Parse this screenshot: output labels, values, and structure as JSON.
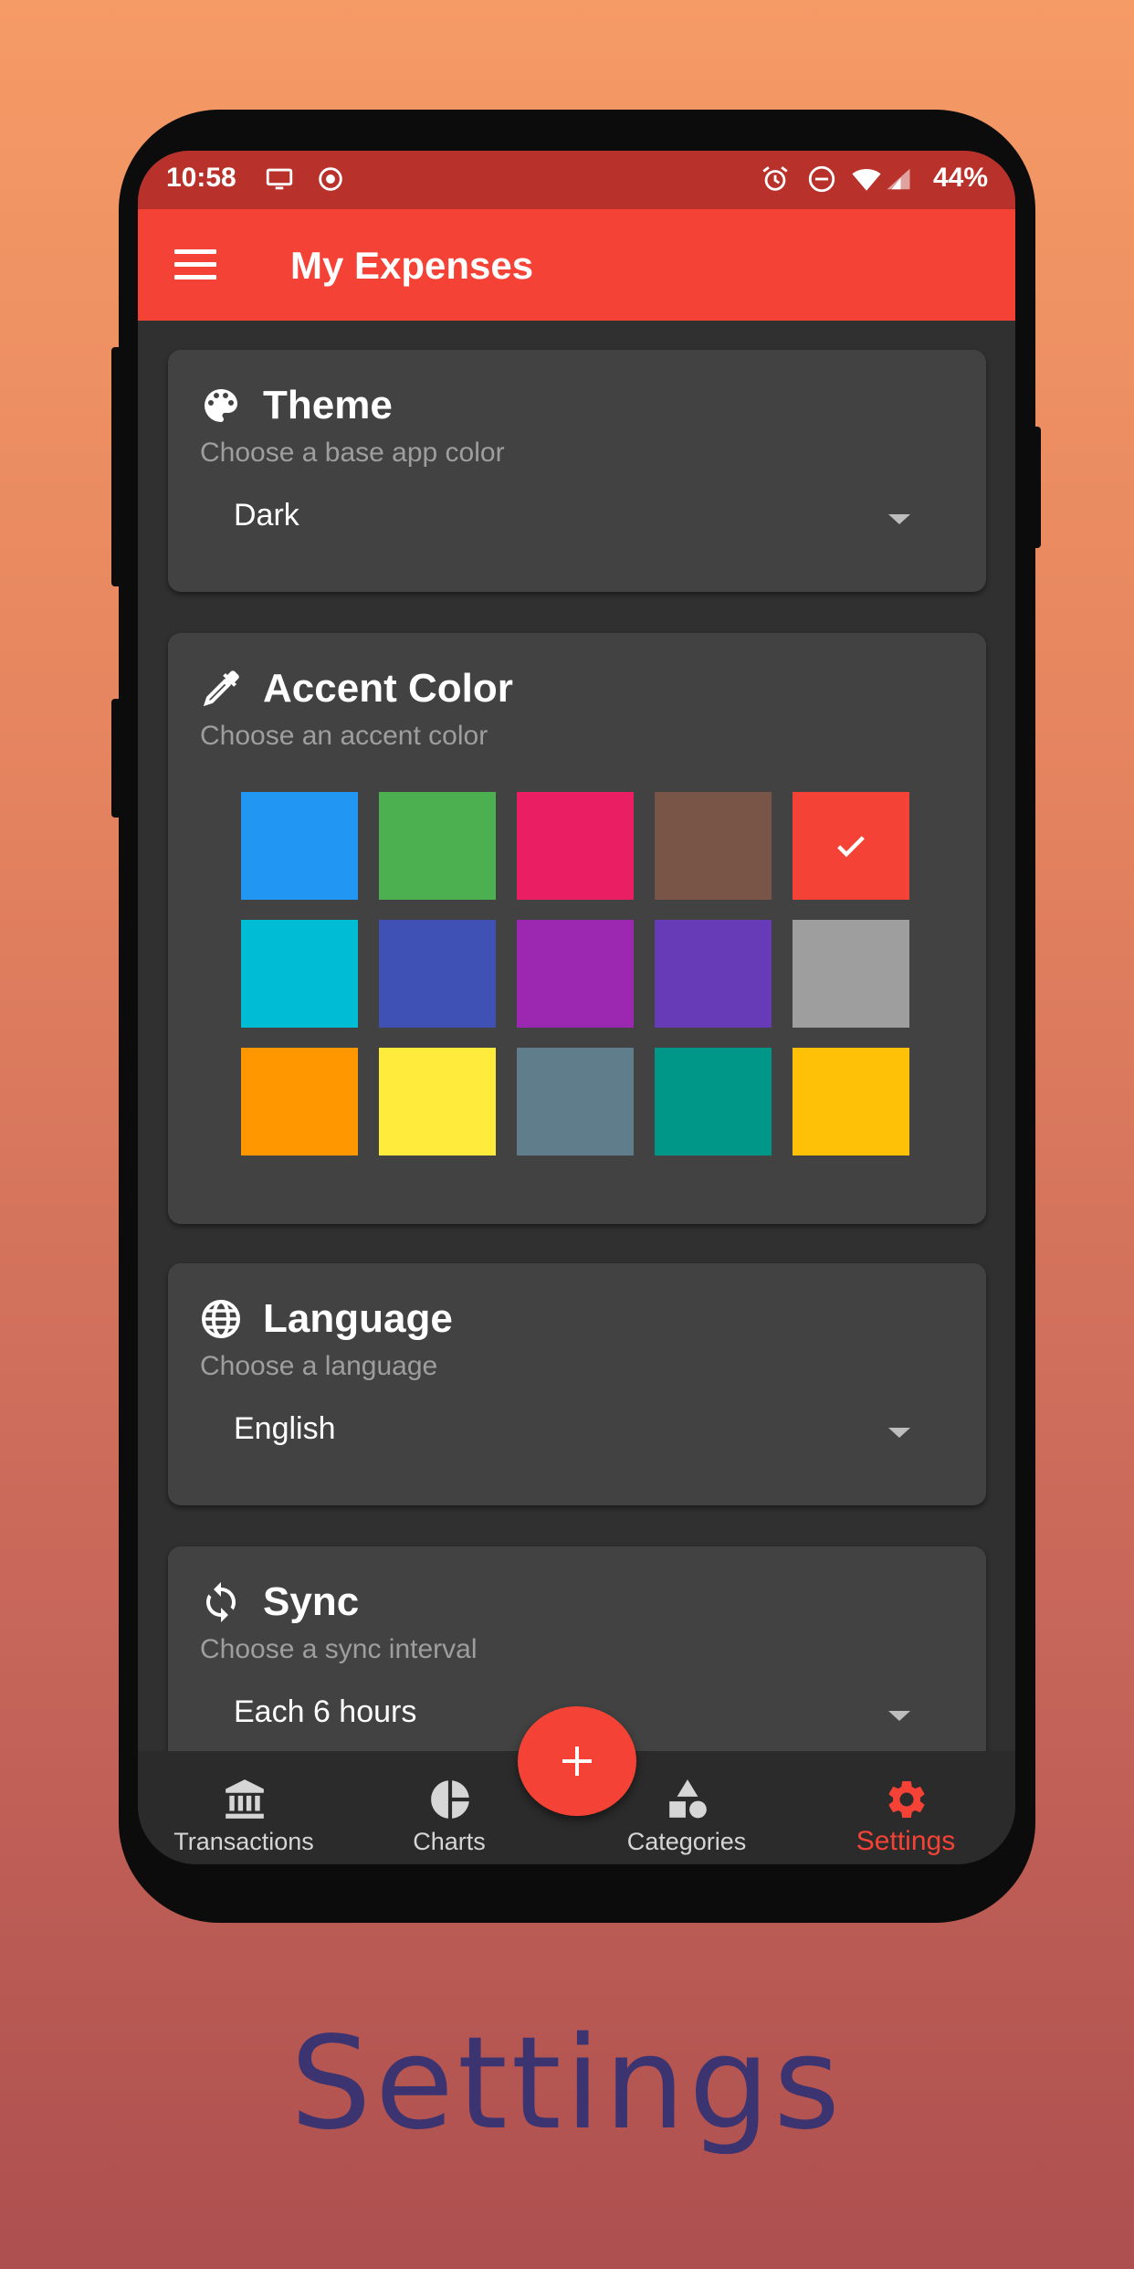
{
  "status_bar": {
    "time": "10:58",
    "battery": "44%",
    "icons": [
      "cast-icon",
      "record-icon",
      "alarm-icon",
      "dnd-icon",
      "wifi-icon",
      "signal-icon"
    ]
  },
  "app_bar": {
    "title": "My Expenses",
    "menu_icon": "hamburger-menu-icon"
  },
  "settings": {
    "theme": {
      "title": "Theme",
      "subtitle": "Choose a base app color",
      "value": "Dark",
      "icon": "palette-icon"
    },
    "accent": {
      "title": "Accent Color",
      "subtitle": "Choose an accent color",
      "icon": "eyedropper-icon",
      "selected_index": 4,
      "colors": [
        "#2196f3",
        "#4caf50",
        "#e91e63",
        "#795548",
        "#f44336",
        "#00bcd4",
        "#3f51b5",
        "#9c27b0",
        "#673ab7",
        "#9e9e9e",
        "#ff9800",
        "#ffeb3b",
        "#607d8b",
        "#009688",
        "#ffc107"
      ]
    },
    "language": {
      "title": "Language",
      "subtitle": "Choose a language",
      "value": "English",
      "icon": "globe-icon"
    },
    "sync": {
      "title": "Sync",
      "subtitle": "Choose a sync interval",
      "value": "Each 6 hours",
      "icon": "sync-icon"
    }
  },
  "fab": {
    "icon": "plus-icon"
  },
  "bottom_nav": {
    "items": [
      {
        "label": "Transactions",
        "icon": "bank-icon"
      },
      {
        "label": "Charts",
        "icon": "pie-chart-icon"
      },
      {
        "label": "Categories",
        "icon": "shapes-icon"
      },
      {
        "label": "Settings",
        "icon": "gear-icon"
      }
    ],
    "active_index": 3
  },
  "colors": {
    "primary": "#f44336",
    "status_bar": "#b9312b",
    "surface": "#424242",
    "background": "#303030"
  },
  "caption": "Settings"
}
